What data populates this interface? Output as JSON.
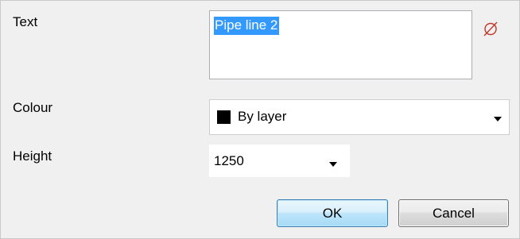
{
  "fields": {
    "text_label": "Text",
    "text_value": "Pipe line 2",
    "colour_label": "Colour",
    "colour_value": "By layer",
    "colour_swatch": "#000000",
    "height_label": "Height",
    "height_value": "1250"
  },
  "icons": {
    "clear": "empty-set-clear-icon",
    "clear_color": "#c0392b"
  },
  "buttons": {
    "ok_label": "OK",
    "cancel_label": "Cancel"
  },
  "colors": {
    "selection": "#3399ff",
    "ok_border": "#3c7fb1"
  }
}
